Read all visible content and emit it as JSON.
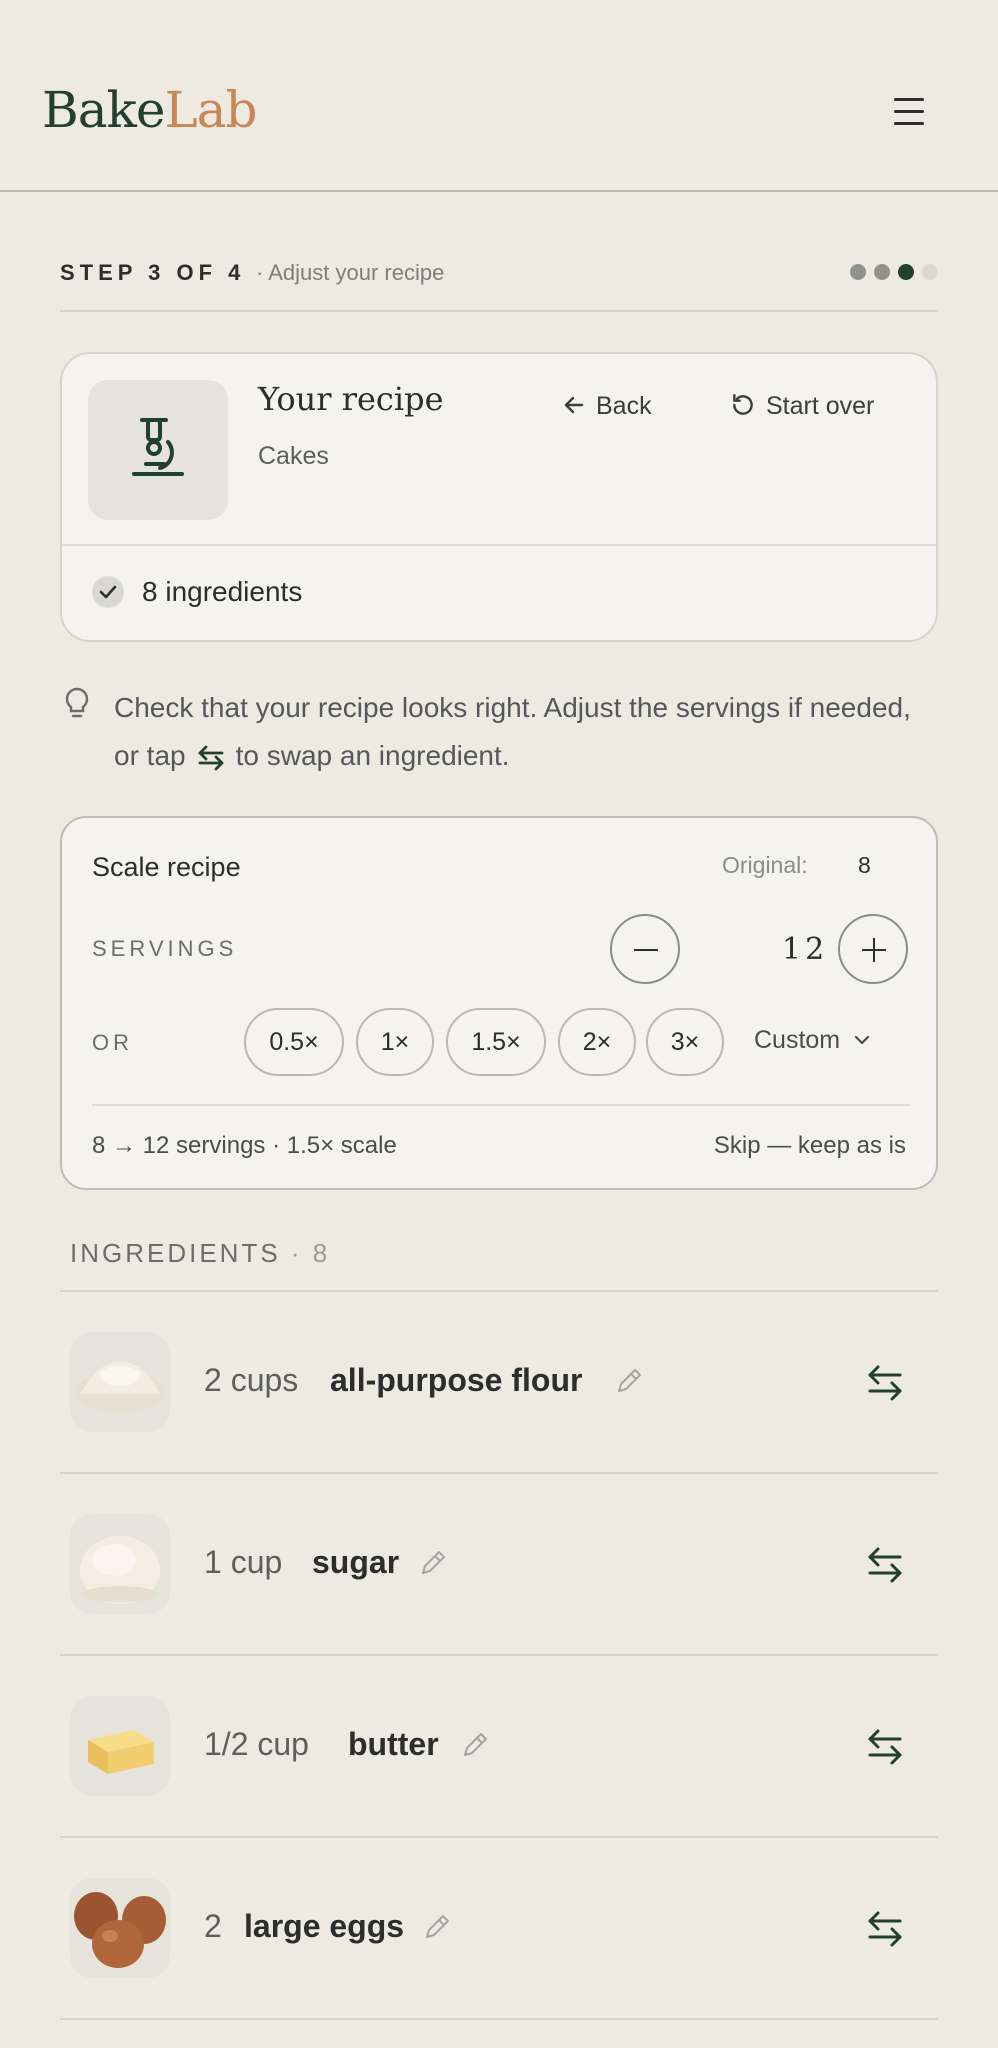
{
  "brand": {
    "part1": "Bake",
    "part2": "Lab",
    "color1": "#23402f",
    "color2": "#c98756"
  },
  "header": {
    "menu_icon": "hamburger-icon"
  },
  "step": {
    "label": "STEP 3 OF 4",
    "subtitle": "· Adjust your recipe",
    "current": 3,
    "total": 4
  },
  "recipe": {
    "title": "Your recipe",
    "category": "Cakes",
    "icon": "microscope-icon",
    "back_label": "Back",
    "start_over_label": "Start over",
    "ingredient_count_label": "8 ingredients"
  },
  "tip": {
    "text_before": "Check that your recipe looks right. Adjust the servings if needed, or tap",
    "text_after": "to swap an ingredient."
  },
  "scale": {
    "title": "Scale recipe",
    "original_label": "Original:",
    "original_value": "8",
    "servings_label": "SERVINGS",
    "servings_value": "12",
    "or_label": "OR",
    "chips": [
      "0.5×",
      "1×",
      "1.5×",
      "2×",
      "3×"
    ],
    "custom_label": "Custom",
    "summary": "8 → 12 servings · 1.5× scale",
    "skip_label": "Skip — keep as is"
  },
  "ingredients": {
    "header": "INGREDIENTS",
    "count": "· 8",
    "items": [
      {
        "qty": "2 cups",
        "name": "all-purpose flour"
      },
      {
        "qty": "1 cup",
        "name": "sugar"
      },
      {
        "qty": "1/2 cup",
        "name": "butter"
      },
      {
        "qty": "2",
        "name": "large eggs"
      }
    ]
  }
}
